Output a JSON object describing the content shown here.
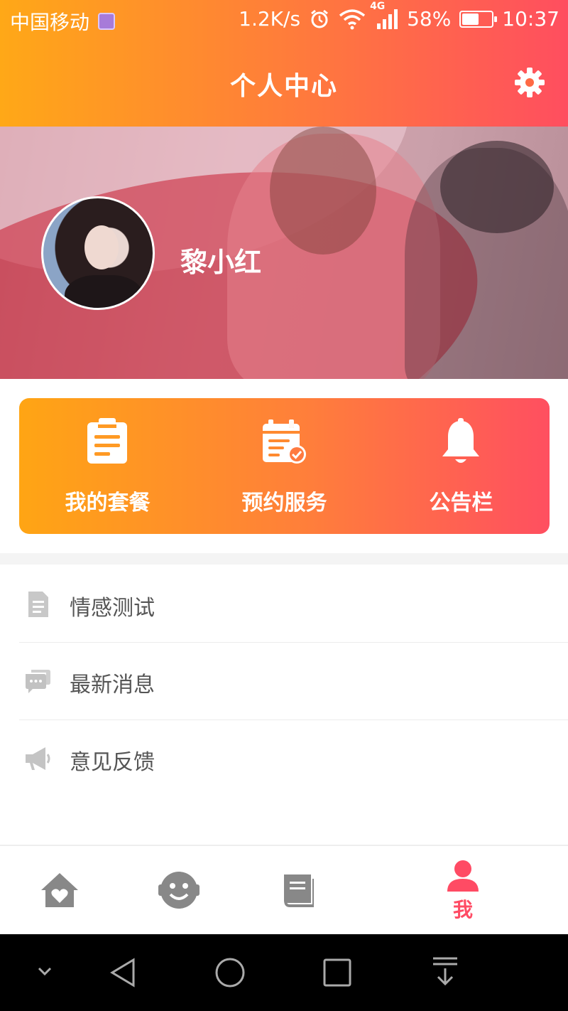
{
  "status_bar": {
    "carrier": "中国移动",
    "speed": "1.2K/s",
    "network": "4G",
    "battery_percent_text": "58%",
    "battery_level": 0.58,
    "time": "10:37"
  },
  "header": {
    "title": "个人中心",
    "settings_icon": "gear-icon"
  },
  "profile": {
    "name": "黎小红"
  },
  "quick_actions": [
    {
      "label": "我的套餐",
      "icon": "clipboard-icon"
    },
    {
      "label": "预约服务",
      "icon": "calendar-check-icon"
    },
    {
      "label": "公告栏",
      "icon": "bell-icon"
    }
  ],
  "menu": [
    {
      "label": "情感测试",
      "icon": "document-icon"
    },
    {
      "label": "最新消息",
      "icon": "chat-bubble-icon"
    },
    {
      "label": "意见反馈",
      "icon": "megaphone-icon"
    }
  ],
  "bottom_nav": {
    "items": [
      {
        "icon": "home-heart-icon",
        "active": false
      },
      {
        "icon": "face-icon",
        "active": false
      },
      {
        "icon": "book-icon",
        "active": false
      },
      {
        "icon": "person-icon",
        "label": "我",
        "active": true
      }
    ],
    "active_color": "#ff4b64",
    "inactive_color": "#888888"
  },
  "colors": {
    "gradient_start": "#ffa817",
    "gradient_end": "#ff4e5f"
  }
}
